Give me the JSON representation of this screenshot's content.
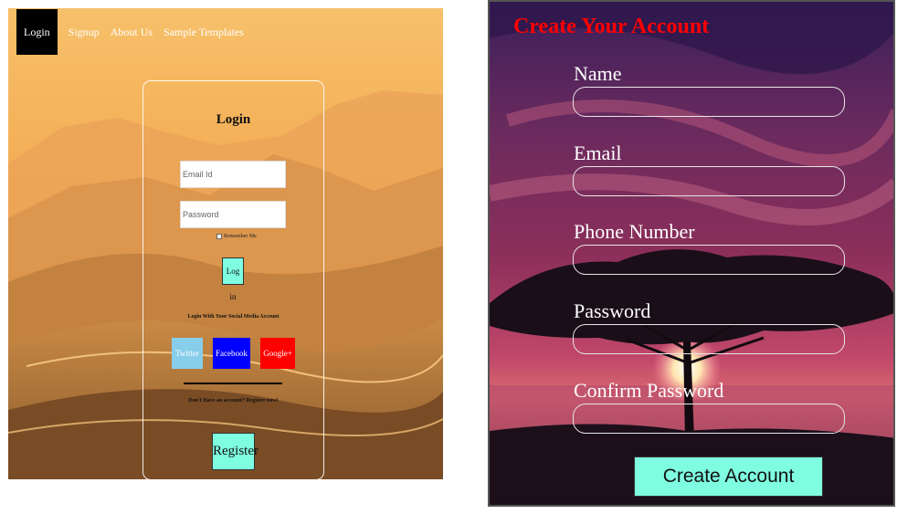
{
  "left_panel": {
    "nav": {
      "items": [
        {
          "label": "Login"
        },
        {
          "label": "Signup"
        },
        {
          "label": "About Us"
        },
        {
          "label": "Sample Templates"
        }
      ]
    },
    "login_form": {
      "title": "Login",
      "email_placeholder": "Email Id",
      "password_placeholder": "Password",
      "remember_me_label": "Remember Me",
      "login_button": "Log in",
      "social_text": "Login With Your Social Media Account",
      "social_buttons": {
        "twitter": "Twitter",
        "facebook": "Facebook",
        "google": "Google+"
      },
      "no_account_text": "Don't Have an account? Register now!",
      "register_button": "Register"
    },
    "colors": {
      "button_bg": "#7ffde0",
      "twitter": "#87ceeb",
      "facebook": "#0000ff",
      "google": "#ff0000"
    }
  },
  "right_panel": {
    "title": "Create Your Account",
    "fields": [
      {
        "label": "Name"
      },
      {
        "label": "Email"
      },
      {
        "label": "Phone Number"
      },
      {
        "label": "Password"
      },
      {
        "label": "Confirm Password"
      }
    ],
    "submit_button": "Create Account",
    "colors": {
      "title": "#ff0000",
      "button_bg": "#7ffde0"
    }
  }
}
